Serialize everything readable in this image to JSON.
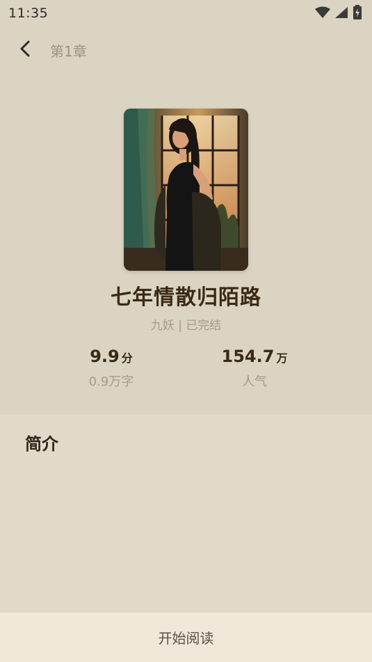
{
  "status_bar": {
    "time": "11:35"
  },
  "header": {
    "chapter": "第1章"
  },
  "book": {
    "title": "七年情散归陌路",
    "meta": "九妖 | 已完结",
    "rating": {
      "value": "9.9",
      "unit": "分",
      "label": "0.9万字"
    },
    "popularity": {
      "value": "154.7",
      "unit": "万",
      "label": "人气"
    }
  },
  "intro": {
    "title": "简介"
  },
  "footer": {
    "start_reading": "开始阅读"
  },
  "colors": {
    "background": "#dbd4c2",
    "panel": "#e1dacb",
    "footer": "#f0e9da",
    "title": "#3a2a14"
  },
  "icons": {
    "back": "chevron-left-icon",
    "wifi": "wifi-icon",
    "signal": "signal-icon",
    "battery": "battery-charging-icon"
  }
}
